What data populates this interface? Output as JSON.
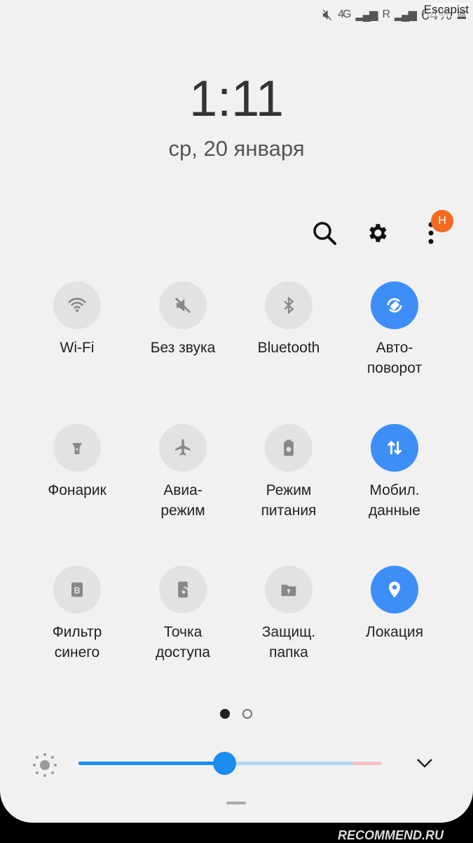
{
  "status_bar": {
    "network": "4G",
    "roaming": "R",
    "battery": "64%",
    "watermark_user": "Escapist"
  },
  "lock": {
    "time": "1:11",
    "date": "ср, 20 января"
  },
  "toolbar": {
    "search_icon": "search-icon",
    "settings_icon": "gear-icon",
    "more_icon": "more-vert-icon",
    "badge": "H"
  },
  "tiles": [
    {
      "label": "Wi-Fi",
      "on": false,
      "icon": "wifi"
    },
    {
      "label": "Без звука",
      "on": false,
      "icon": "mute"
    },
    {
      "label": "Bluetooth",
      "on": false,
      "icon": "bluetooth"
    },
    {
      "label": "Авто-\nповорот",
      "on": true,
      "icon": "autorotate"
    },
    {
      "label": "Фонарик",
      "on": false,
      "icon": "flashlight"
    },
    {
      "label": "Авиа-\nрежим",
      "on": false,
      "icon": "airplane"
    },
    {
      "label": "Режим\nпитания",
      "on": false,
      "icon": "battery-saver"
    },
    {
      "label": "Мобил.\nданные",
      "on": true,
      "icon": "mobile-data"
    },
    {
      "label": "Фильтр\nсинего",
      "on": false,
      "icon": "blue-light-filter"
    },
    {
      "label": "Точка\nдоступа",
      "on": false,
      "icon": "hotspot"
    },
    {
      "label": "Защищ.\nпапка",
      "on": false,
      "icon": "secure-folder"
    },
    {
      "label": "Локация",
      "on": true,
      "icon": "location"
    }
  ],
  "pager": {
    "current": 1,
    "total": 2
  },
  "brightness": {
    "level_percent": 48
  },
  "colors": {
    "accent": "#3e8ef7",
    "slider": "#1a8cf0",
    "badge": "#f26b21"
  },
  "watermark": "RECOMMEND.RU"
}
